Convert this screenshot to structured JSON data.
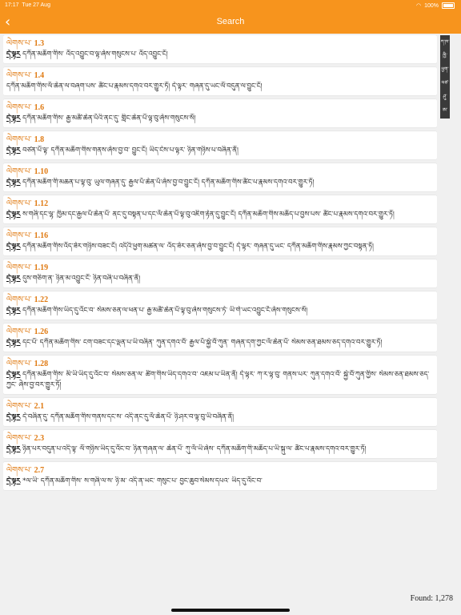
{
  "status": {
    "time": "17:17",
    "date": "Tue 27 Aug",
    "battery": "100%"
  },
  "header": {
    "title": "Search"
  },
  "results": [
    {
      "prefix": "ལེགས་པ་",
      "verse": "1.3",
      "hl": "དེ་ལྟར",
      "text": "དཀོན་མཆོག་གིས་ འོད་འབྱུང་བ་ལྟ་ཞེས་གསུངས་པ་ འོད་འབྱུང་ངོ།"
    },
    {
      "prefix": "ལེགས་པ་",
      "verse": "1.4",
      "hl": "",
      "text": "དཀོན་མཆོག་གིས་ལོ་ཆེན་ལ་བཞག་པས་ ཚོང་པ་རྣམས་དགའ་བར་གྱུར་ཏོ། དེ་ལྟར་ གཞན་དུ་ཡང་ལོ་བདུན་ལ་བྱུང་ངོ།"
    },
    {
      "prefix": "ལེགས་པ་",
      "verse": "1.6",
      "hl": "དེ་ལྟར",
      "text": "དཀོན་མཆོག་གིས་ རྒྱ་མཚོ་ཆེན་པོའི་ནང་དུ་ གླིང་ཆེན་པོ་ལྟ་བུ་ཞེས་གསུངས་སོ།"
    },
    {
      "prefix": "ལེགས་པ་",
      "verse": "1.8",
      "hl": "དེ་ལྟར",
      "text": "བཙན་པོ་ལྟ་ དཀོན་མཆོག་གིས་གནས་ཞེས་བྱ་བ་ བྱུང་ངོ། ཡིད་ངེས་པ་ལྟར་ ཉིན་གཉིས་པ་བཞིན་ནོ།"
    },
    {
      "prefix": "ལེགས་པ་",
      "verse": "1.10",
      "hl": "དེ་ལྟར",
      "text": "དཀོན་མཆོག་གི་མཆན་པ་ལྟ་བུ་ ཡུལ་གཞན་དུ་ རྒྱལ་པོ་ཆེན་པོ་ཞེས་བྱ་བ་བྱུང་ངོ། དཀོན་མཆོག་གིས་ཚོང་པ་རྣམས་དགའ་བར་གྱུར་ཏོ།"
    },
    {
      "prefix": "ལེགས་པ་",
      "verse": "1.12",
      "hl": "དེ་ལྟར",
      "text": "ས་གཞི་དང་ལྷ་ ཁྱིམ་དང་རྒྱལ་པོ་ཆེན་པོ་ ནང་དུ་བསྟན་པ་དང་ལོ་ཆེན་པོ་ལྟ་བུ་འཇིག་རྟེན་དུ་བྱུང་ངོ། དཀོན་མཆོག་གིས་མཆོད་པ་བྱས་པས་ ཚོང་པ་རྣམས་དགའ་བར་གྱུར་ཏོ།"
    },
    {
      "prefix": "ལེགས་པ་",
      "verse": "1.16",
      "hl": "དེ་ལྟར",
      "text": "དཀོན་མཆོག་གིས་འོད་ཟེར་གཉིས་བཟང་ངོ། འདིའི་ཕྱག་མཚན་ལ་ འོད་ཟེར་ཅན་ཞེས་བྱ་བ་བྱུང་ངོ། དེ་ལྟར་ གཞན་དུ་ཡང་ དཀོན་མཆོག་གིས་རྣམས་ཀྱང་བསྟན་ཏོ།"
    },
    {
      "prefix": "ལེགས་པ་",
      "verse": "1.19",
      "hl": "དེ་ལྟར",
      "text": "དུས་གཅིག་ན་ ཉིན་མ་འབྱུང་ངོ་ ཉིན་བཞི་པ་བཞིན་ནོ།"
    },
    {
      "prefix": "ལེགས་པ་",
      "verse": "1.22",
      "hl": "དེ་ལྟར",
      "text": "དཀོན་མཆོག་གིས་ཡིད་དུ་འོང་བ་ སེམས་ཅན་ལ་ཕན་པ་ རྒྱ་མཚོ་ཆེན་པོ་ལྟ་བུ་ཞེས་གསུངས་ཏེ་ ཡི་གེ་ཡང་འབྱུང་ངོ་ཞེས་གསུངས་སོ།"
    },
    {
      "prefix": "ལེགས་པ་",
      "verse": "1.26",
      "hl": "དེ་ལྟར",
      "text": "དང་པོ་ དཀོན་མཆོག་གིས་ ངག་བཟང་དང་ལྡན་པ་ཡི་བཞིན་ ཀུན་དགའ་བོ་ རྒྱལ་པོ་སྐྱེ་བོ་ཀུན་ གཞན་དག་ཀྱང་ལོ་ཆེན་པོ་ སེམས་ཅན་ཐམས་ཅད་དགའ་བར་གྱུར་ཏོ།"
    },
    {
      "prefix": "ལེགས་པ་",
      "verse": "1.28",
      "hl": "དེ་ལྟར",
      "text": "དཀོན་མཆོག་གིས་ མི་ཡི་ཡིད་དུ་འོང་བ་ སེམས་ཅན་ལ་ ཚིག་གིས་ཡིད་དགའ་བ་ འཇམ་པ་ཡིན་ནོ། དེ་ལྟར་ ཀ་ར་ལྟ་བུ་ གནས་པར་ ཀུན་དགའ་བོ་ སྐྱེ་བོ་ཀུན་གྱིས་ སེམས་ཅན་ཐམས་ཅད་ཀྱང་ ཞེས་བྱ་བར་གྱུར་ཏོ།"
    },
    {
      "prefix": "ལེགས་པ་",
      "verse": "2.1",
      "hl": "དེ་ལྟར",
      "text": "དེ་བཞིན་དུ་ དཀོན་མཆོག་གིས་གནས་དང་ས་ འདི་ནང་དུ་ལོ་ཆེན་པོ་ ཉི་ཤར་བ་ལྟ་བུ་ཡི་བཞིན་ནོ།"
    },
    {
      "prefix": "ལེགས་པ་",
      "verse": "2.3",
      "hl": "དེ་ལྟར",
      "text": "ཉིན་པར་བདུན་པ་འདི་ལྟ་ ལོ་གཉིས་ཡིད་དུ་འོང་བ་ ཉིན་གཞན་ལ་ ཆེན་པོ་ ཀུ་ལོ་ཡི་ཞེས་ དཀོན་མཆོག་གི་མཆོད་པ་ཡི་སྐུ་ལ་ ཚོང་པ་རྣམས་དགའ་བར་གྱུར་ཏོ།"
    },
    {
      "prefix": "ལེགས་པ་",
      "verse": "2.7",
      "hl": "དེ་ལྟར",
      "text": "*ལ་ཡི་ དཀོན་མཆོག་གིས་ ས་གཞི་ལ་ས་ ཉི་མ་ འདི་ན་ཡང་ གསུང་པ་ བྱང་ཆུབ་སེམས་དཔའ་ ཡིད་དུ་འོང་བ་"
    }
  ],
  "index_strip": [
    "ཀ་ཁ་",
    "ཁྱི་",
    "ཕྱག་",
    "ཕཙ་",
    "ཤུ་",
    "ཨ་"
  ],
  "found": "Found: 1,278"
}
